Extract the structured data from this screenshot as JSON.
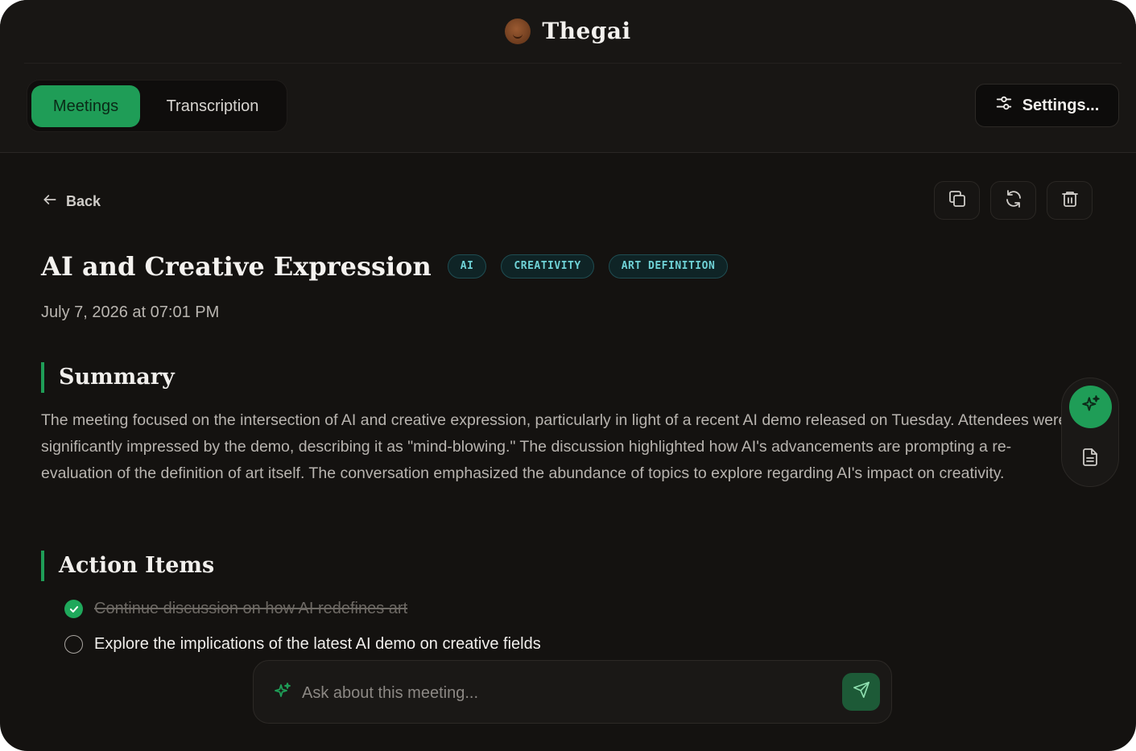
{
  "app": {
    "title": "Thegai"
  },
  "tabs": [
    {
      "label": "Meetings",
      "active": true
    },
    {
      "label": "Transcription",
      "active": false
    }
  ],
  "settings": {
    "label": "Settings..."
  },
  "nav": {
    "back_label": "Back"
  },
  "toolbar": {
    "icons": [
      "copy-icon",
      "refresh-icon",
      "trash-icon"
    ]
  },
  "meeting": {
    "title": "AI and Creative Expression",
    "tags": [
      "AI",
      "CREATIVITY",
      "ART DEFINITION"
    ],
    "date": "July 7, 2026 at 07:01 PM",
    "summary_heading": "Summary",
    "summary": "The meeting focused on the intersection of AI and creative expression, particularly in light of a recent AI demo released on Tuesday. Attendees were significantly impressed by the demo, describing it as \"mind-blowing.\" The discussion highlighted how AI's advancements are prompting a re-evaluation of the definition of art itself. The conversation emphasized the abundance of topics to explore regarding AI's impact on creativity.",
    "action_items_heading": "Action Items",
    "action_items": [
      {
        "text": "Continue discussion on how AI redefines art",
        "done": true
      },
      {
        "text": "Explore the implications of the latest AI demo on creative fields",
        "done": false
      }
    ]
  },
  "ask": {
    "placeholder": "Ask about this meeting..."
  },
  "colors": {
    "accent": "#1f9d57",
    "background": "#141210",
    "tag_text": "#6fd2d6",
    "tag_border": "#1f4d52"
  }
}
